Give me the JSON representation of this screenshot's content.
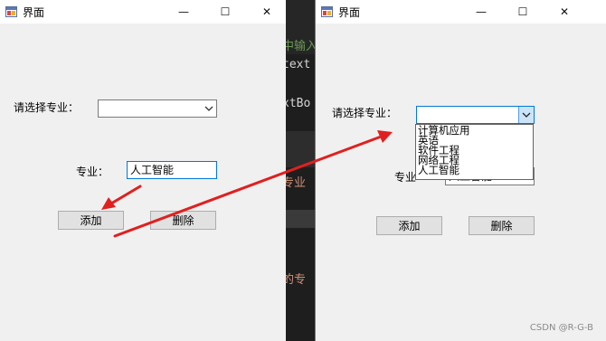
{
  "background_editor": {
    "fragments": [
      "中输入",
      "text",
      "xtBo",
      "专业",
      "的专"
    ],
    "colors": {
      "comment": "#6a9955",
      "text": "#d4d4d4",
      "string": "#ce9178"
    }
  },
  "left_window": {
    "title": "界面",
    "major_label": "请选择专业：",
    "combo_value": "",
    "major_field_label": "专业：",
    "major_text": "人工智能",
    "add_button": "添加",
    "delete_button": "删除"
  },
  "right_window": {
    "title": "界面",
    "major_label": "请选择专业：",
    "combo_value": "",
    "dropdown_options": [
      "计算机应用",
      "英语",
      "软件工程",
      "网络工程",
      "人工智能"
    ],
    "major_field_label": "专业",
    "major_text": "人工智能",
    "add_button": "添加",
    "delete_button": "删除"
  },
  "window_controls": {
    "minimize": "—",
    "maximize": "☐",
    "close": "✕"
  },
  "icons": {
    "app": "app-icon",
    "combo_arrow": "chevron-down-icon"
  },
  "annotation_color": "#e02020",
  "watermark": "CSDN @R-G-B"
}
